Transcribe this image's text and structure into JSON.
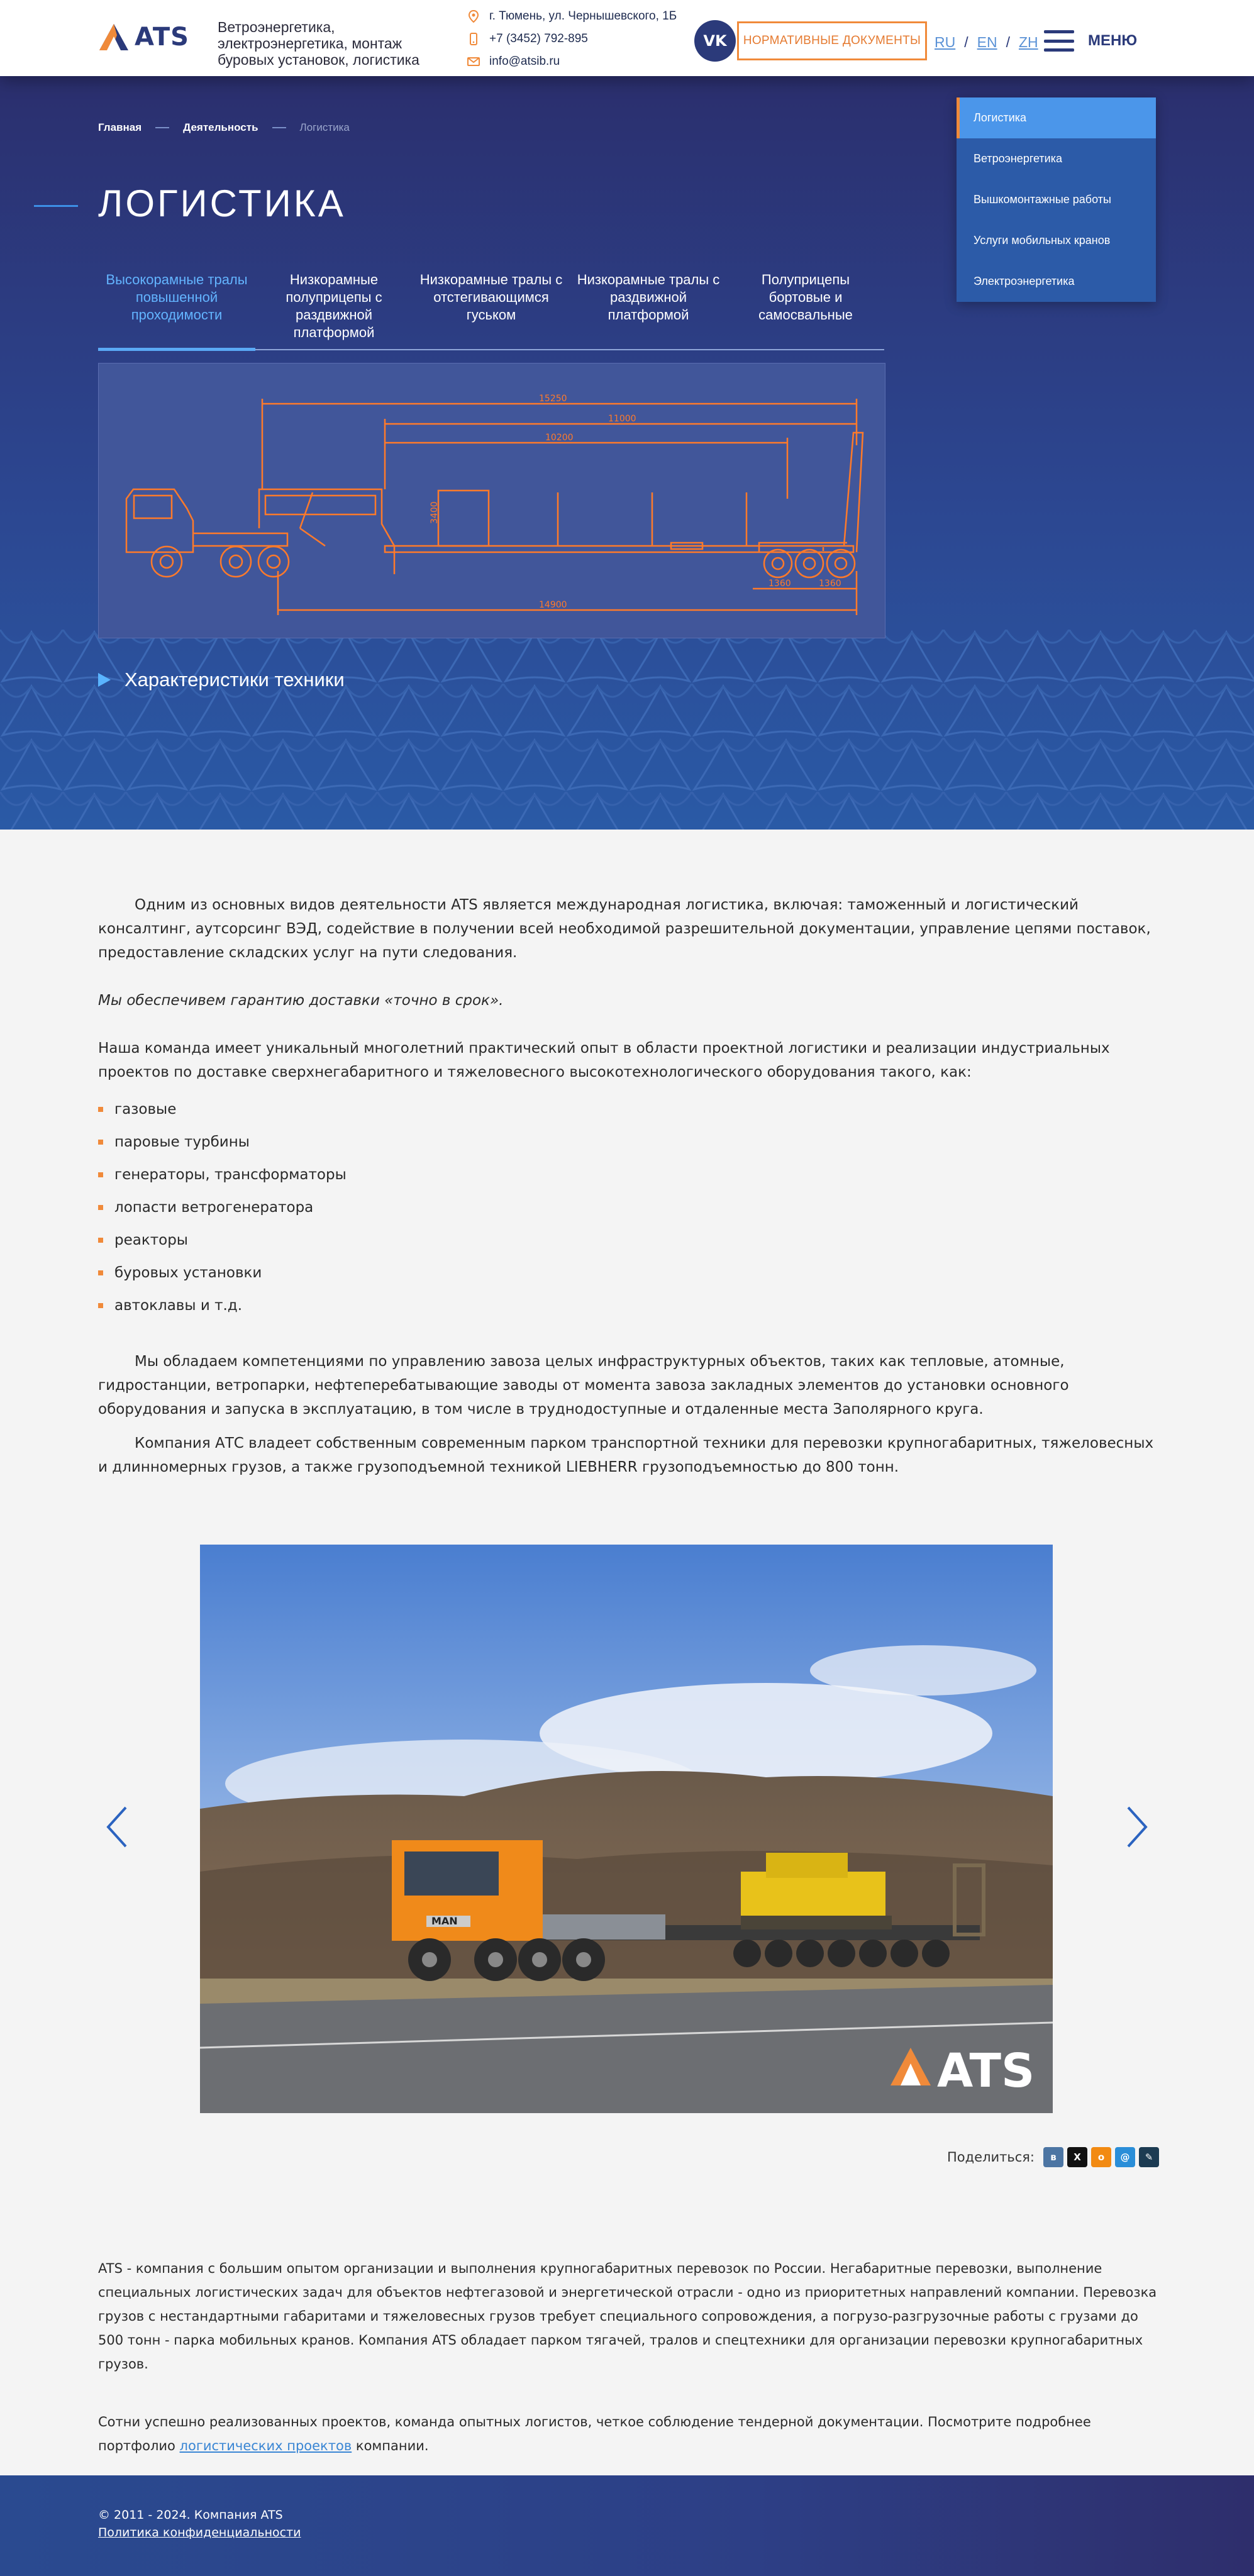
{
  "header": {
    "logo_text": "ATS",
    "tagline": "Ветроэнергетика, электроэнергетика, монтаж буровых установок, логистика",
    "address": "г. Тюмень, ул. Чернышевского, 1Б",
    "phone": "+7 (3452) 792-895",
    "email": "info@atsib.ru",
    "vk_label": "VK",
    "docs_button": "НОРМАТИВНЫЕ ДОКУМЕНТЫ",
    "languages": [
      "RU",
      "EN",
      "ZH"
    ],
    "menu_label": "МЕНЮ"
  },
  "breadcrumb": [
    "Главная",
    "Деятельность",
    "Логистика"
  ],
  "page_title": "ЛОГИСТИКА",
  "tabs": [
    {
      "label": "Высокорамные тралы повышенной проходимости",
      "active": true
    },
    {
      "label": "Низкорамные полуприцепы с раздвижной платформой",
      "active": false
    },
    {
      "label": "Низкорамные тралы с отстегивающимся гуськом",
      "active": false
    },
    {
      "label": "Низкорамные тралы с раздвижной платформой",
      "active": false
    },
    {
      "label": "Полуприцепы бортовые и самосвальные",
      "active": false
    }
  ],
  "drawing_dimensions": [
    "15250",
    "11000",
    "10200",
    "14900",
    "1360",
    "1360",
    "3400"
  ],
  "specs_label": "Характеристики техники",
  "side_menu": [
    {
      "label": "Логистика",
      "active": true
    },
    {
      "label": "Ветроэнергетика",
      "active": false
    },
    {
      "label": "Вышкомонтажные работы",
      "active": false
    },
    {
      "label": "Услуги мобильных кранов",
      "active": false
    },
    {
      "label": "Электроэнергетика",
      "active": false
    }
  ],
  "content": {
    "intro": "Одним из основных видов деятельности ATS является международная логистика, включая: таможенный и логистический консалтинг, аутсорсинг ВЭД, содействие в получении всей необходимой разрешительной документации, управление цепями поставок, предоставление складских услуг на пути следования.",
    "guarantee": "Мы обеспечивем гарантию доставки «точно в срок».",
    "experience": "Наша команда имеет уникальный многолетний практический опыт в области проектной логистики и реализации индустриальных проектов по доставке сверхнегабаритного и тяжеловесного высокотехнологического оборудования такого, как:",
    "list": [
      "газовые",
      "паровые турбины",
      "генераторы, трансформаторы",
      "лопасти ветрогенератора",
      "реакторы",
      "буровых установки",
      "автоклавы и т.д."
    ],
    "competence": "Мы обладаем компетенциями по управлению завоза целых инфраструктурных объектов, таких как тепловые, атомные, гидростанции, ветропарки, нефтеперебатывающие заводы от момента завоза закладных элементов до установки основного оборудования и запуска в эксплуатацию, в том числе в труднодоступные и отдаленные места Заполярного круга.",
    "fleet": "Компания АТС владеет собственным современным парком транспортной техники для перевозки крупногабаритных, тяжеловесных и длинномерных грузов, а также грузоподъемной техникой LIEBHERR грузоподъемностью до 800 тонн."
  },
  "slide": {
    "truck_badge": "MAN",
    "watermark": "ATS"
  },
  "share": {
    "label": "Поделиться:",
    "networks": [
      "vk",
      "x",
      "ok",
      "mail",
      "lj"
    ]
  },
  "about": {
    "p1": "ATS - компания с большим опытом организации и выполнения крупногабаритных перевозок по России. Негабаритные перевозки, выполнение специальных логистических задач для объектов нефтегазовой и энергетической отрасли - одно из приоритетных направлений компании. Перевозка грузов с нестандартными габаритами и тяжеловесных грузов требует специального сопровождения, а погрузо-разгрузочные работы с грузами до 500 тонн - парка мобильных кранов. Компания ATS обладает парком тягачей, тралов и спецтехники для организации перевозки крупногабаритных грузов.",
    "p2_before": "Сотни успешно реализованных проектов, команда опытных логистов, четкое соблюдение тендерной документации. Посмотрите подробнее портфолио ",
    "p2_link": "логистических проектов",
    "p2_after": " компании."
  },
  "footer": {
    "copyright": "© 2011 - 2024. Компания ATS",
    "privacy": "Политика конфиденциальности"
  },
  "colors": {
    "navy": "#2b3a7a",
    "orange": "#f08a3a",
    "accent_blue": "#4b96ea",
    "drawing_line": "#ff7a2a"
  }
}
